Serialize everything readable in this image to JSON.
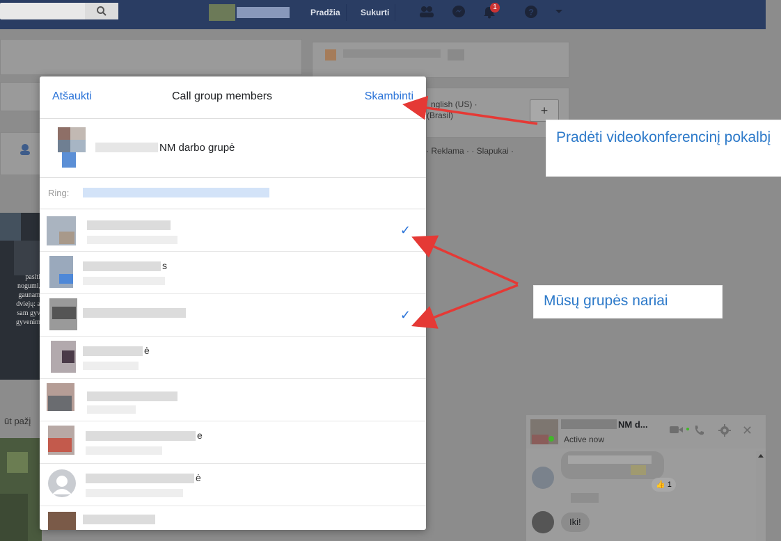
{
  "topbar": {
    "links": [
      "Pradžia",
      "Sukurti"
    ],
    "notification_badge": "1"
  },
  "background": {
    "languages": "nglish (US) ·",
    "languages2": "(Brasil)",
    "footer_links": "· Reklama · · Slapukai ·",
    "post_snippet": "ūt pažį",
    "post_text": [
      "pasiti",
      "nogumi,",
      "gaunam",
      "dviejų: a",
      "sam gyv",
      "gyvenim"
    ]
  },
  "modal": {
    "cancel_label": "Atšaukti",
    "title": "Call group members",
    "call_label": "Skambinti",
    "group_name": "NM darbo grupė",
    "ring_label": "Ring:",
    "members": [
      {
        "suffix": "",
        "checked": true
      },
      {
        "suffix": "s",
        "checked": false
      },
      {
        "suffix": "",
        "checked": true
      },
      {
        "suffix": "ė",
        "checked": false
      },
      {
        "suffix": "",
        "checked": false
      },
      {
        "suffix": "e",
        "checked": false
      },
      {
        "suffix": "ė",
        "checked": false
      },
      {
        "suffix": "",
        "checked": false
      }
    ]
  },
  "callouts": {
    "call_annotation": "Pradėti videokonferencinį pokalbį",
    "members_annotation": "Mūsų grupės nariai"
  },
  "chat": {
    "title": "NM d...",
    "status": "Active now",
    "reaction_count": "1",
    "message": "Iki!"
  },
  "colors": {
    "accent": "#2a73d8",
    "topbar": "#2a3d63",
    "arrow": "#e53935",
    "callout_text": "#2c79c9"
  }
}
